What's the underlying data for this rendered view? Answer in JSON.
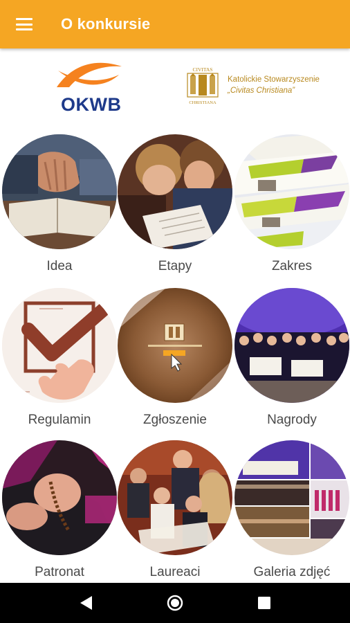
{
  "appbar": {
    "title": "O konkursie",
    "background": "#f5a623",
    "menu_icon": "hamburger-menu-icon"
  },
  "logos": {
    "okwb": {
      "text": "OKWB",
      "fish_color": "#f5821f",
      "text_color": "#1e3a8a"
    },
    "civitas": {
      "emblem_top": "CIVITAS",
      "emblem_bottom": "CHRISTIANA",
      "line1": "Katolickie Stowarzyszenie",
      "line2": "„Civitas Christiana”",
      "color": "#b8891f"
    }
  },
  "tiles": [
    {
      "label": "Idea",
      "icon": "praying-hands-bible-photo"
    },
    {
      "label": "Etapy",
      "icon": "students-writing-photo"
    },
    {
      "label": "Zakres",
      "icon": "printed-leaflets-photo"
    },
    {
      "label": "Regulamin",
      "icon": "checkbox-checkmark-icon"
    },
    {
      "label": "Zgłoszenie",
      "icon": "registration-click-icon"
    },
    {
      "label": "Nagrody",
      "icon": "award-winners-stage-photo"
    },
    {
      "label": "Patronat",
      "icon": "bishop-rosary-photo"
    },
    {
      "label": "Laureaci",
      "icon": "laureates-ceremony-photo"
    },
    {
      "label": "Galeria zdjęć",
      "icon": "photo-collage-gallery"
    }
  ],
  "navbar": {
    "back_icon": "back-triangle-icon",
    "home_icon": "home-circle-icon",
    "recents_icon": "recents-square-icon"
  }
}
